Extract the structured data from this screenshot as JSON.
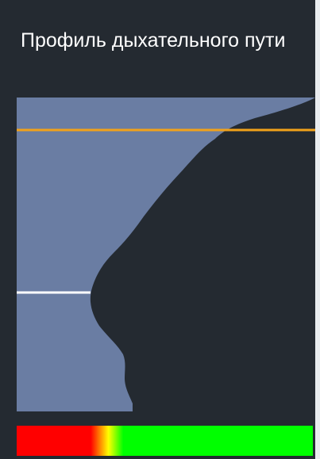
{
  "panel": {
    "title": "Профиль дыхательного пути",
    "background_color": "#242a31"
  },
  "profile": {
    "fill_color": "#6a7da3",
    "upper_marker_color": "#f2a21a",
    "lower_marker_color": "#ffffff"
  },
  "gradient_bar": {
    "colors": [
      "#ff0000",
      "#ffff00",
      "#00ff00"
    ]
  }
}
